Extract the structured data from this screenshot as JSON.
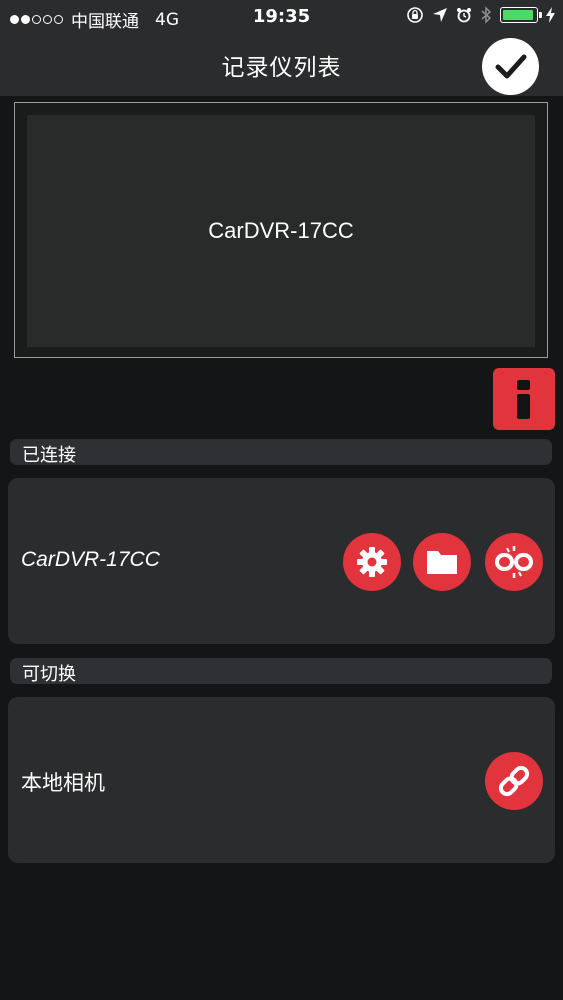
{
  "status_bar": {
    "carrier": "中国联通",
    "network": "4G",
    "time": "19:35",
    "battery_color": "#4cd964"
  },
  "nav": {
    "title": "记录仪列表",
    "done_icon": "checkmark-icon"
  },
  "preview": {
    "device_name": "CarDVR-17CC"
  },
  "info_button": {
    "icon": "info-icon"
  },
  "sections": {
    "connected": {
      "header": "已连接",
      "device_name": "CarDVR-17CC",
      "actions": [
        "gear-icon",
        "folder-icon",
        "unlink-icon"
      ]
    },
    "switchable": {
      "header": "可切换",
      "device_name": "本地相机",
      "actions": [
        "link-icon"
      ]
    }
  },
  "colors": {
    "accent": "#e1343d",
    "bar_background": "#2b2c2e",
    "page_background": "#141516"
  }
}
